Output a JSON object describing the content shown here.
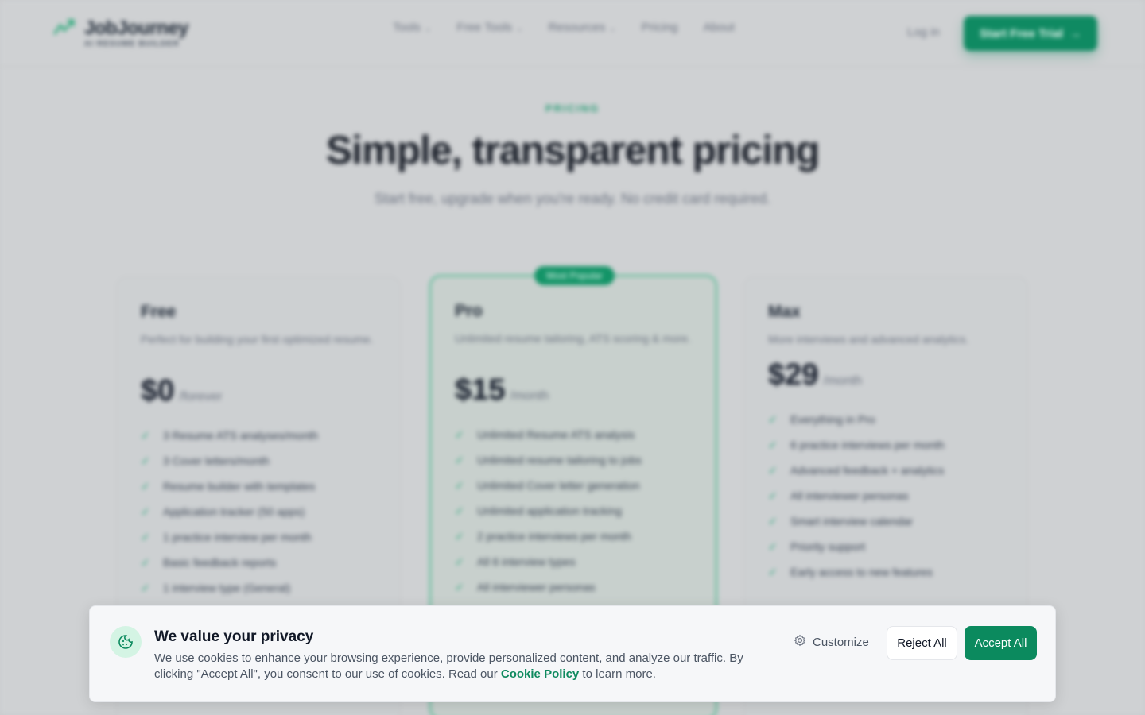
{
  "brand": {
    "name": "JobJourney",
    "tagline": "AI RESUME BUILDER"
  },
  "nav": {
    "items": [
      {
        "label": "Tools",
        "has_dropdown": true
      },
      {
        "label": "Free Tools",
        "has_dropdown": true
      },
      {
        "label": "Resources",
        "has_dropdown": true
      },
      {
        "label": "Pricing",
        "has_dropdown": false
      },
      {
        "label": "About",
        "has_dropdown": false
      }
    ],
    "login": "Log in",
    "cta": "Start Free Trial"
  },
  "hero": {
    "eyebrow": "PRICING",
    "title": "Simple, transparent pricing",
    "subtitle": "Start free, upgrade when you're ready. No credit card required."
  },
  "plans": [
    {
      "name": "Free",
      "description": "Perfect for building your first optimized resume.",
      "price": "$0",
      "period": "/forever",
      "features": [
        "3 Resume ATS analyses/month",
        "3 Cover letters/month",
        "Resume builder with templates",
        "Application tracker (50 apps)",
        "1 practice interview per month",
        "Basic feedback reports",
        "1 interview type (General)"
      ]
    },
    {
      "name": "Pro",
      "badge": "Most Popular",
      "description": "Unlimited resume tailoring, ATS scoring & more.",
      "price": "$15",
      "period": "/month",
      "features": [
        "Unlimited Resume ATS analysis",
        "Unlimited resume tailoring to jobs",
        "Unlimited Cover letter generation",
        "Unlimited application tracking",
        "2 practice interviews per month",
        "All 6 interview types",
        "All interviewer personas"
      ]
    },
    {
      "name": "Max",
      "description": "More interviews and advanced analytics.",
      "price": "$29",
      "period": "/month",
      "features": [
        "Everything in Pro",
        "6 practice interviews per month",
        "Advanced feedback + analytics",
        "All interviewer personas",
        "Smart interview calendar",
        "Priority support",
        "Early access to new features"
      ]
    }
  ],
  "cookie": {
    "title": "We value your privacy",
    "text": "We use cookies to enhance your browsing experience, provide personalized content, and analyze our traffic. By clicking \"Accept All\", you consent to our use of cookies. Read our ",
    "link": "Cookie Policy",
    "text_after": " to learn more.",
    "customize": "Customize",
    "reject": "Reject All",
    "accept": "Accept All"
  },
  "colors": {
    "accent": "#0b8a5e",
    "accent_light": "#d4f4e4"
  }
}
